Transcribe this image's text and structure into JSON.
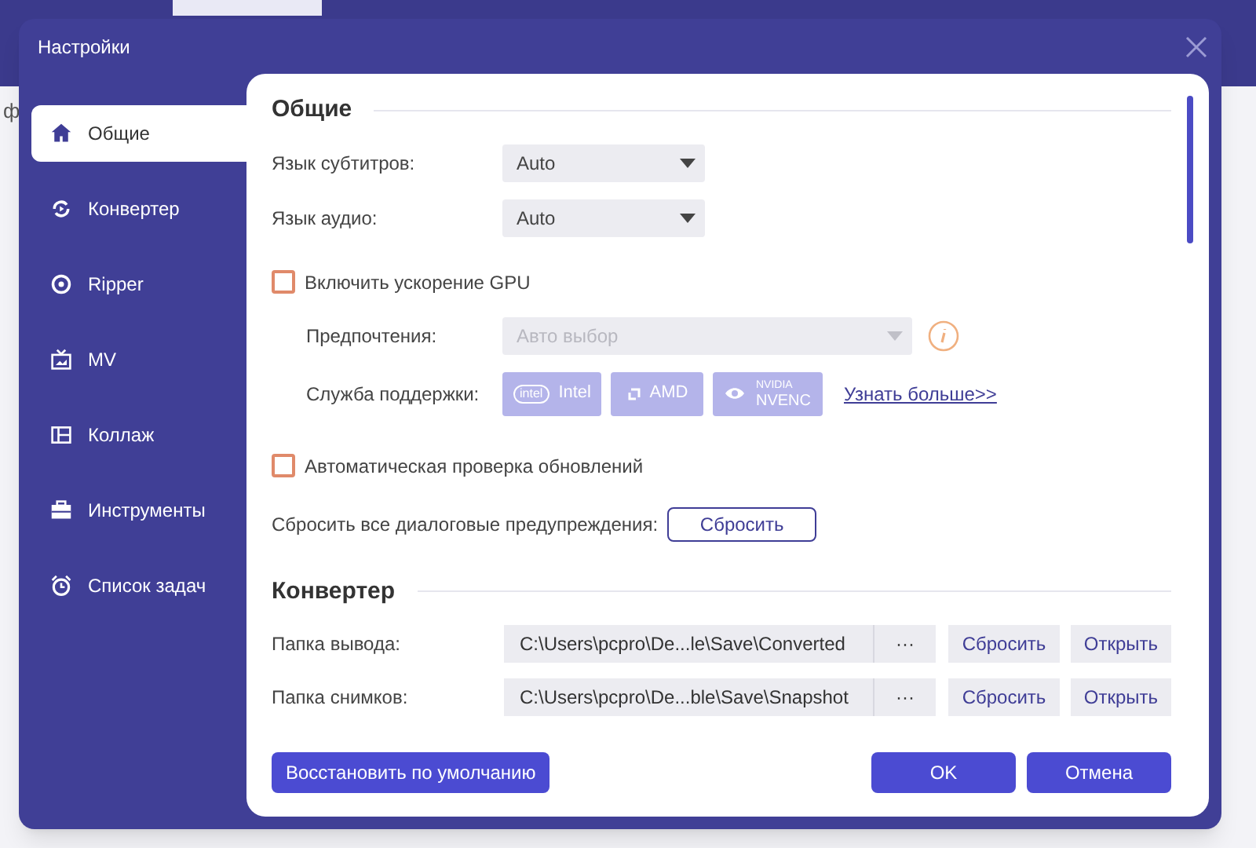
{
  "background": {
    "fragment": "ф"
  },
  "window": {
    "title": "Настройки"
  },
  "sidebar": {
    "items": [
      {
        "label": "Общие",
        "kind": "home",
        "selected": true
      },
      {
        "label": "Конвертер",
        "kind": "convert",
        "selected": false
      },
      {
        "label": "Ripper",
        "kind": "disc",
        "selected": false
      },
      {
        "label": "MV",
        "kind": "tv",
        "selected": false
      },
      {
        "label": "Коллаж",
        "kind": "collage",
        "selected": false
      },
      {
        "label": "Инструменты",
        "kind": "toolbox",
        "selected": false
      },
      {
        "label": "Список задач",
        "kind": "alarm",
        "selected": false
      }
    ]
  },
  "general": {
    "title": "Общие",
    "subtitle_language": {
      "label": "Язык субтитров:",
      "value": "Auto"
    },
    "audio_language": {
      "label": "Язык аудио:",
      "value": "Auto"
    },
    "gpu": {
      "label": "Включить ускорение GPU",
      "checked": false
    },
    "preference": {
      "label": "Предпочтения:",
      "value": "Авто выбор",
      "disabled": true
    },
    "support": {
      "label": "Служба поддержки:",
      "vendors": [
        {
          "kind": "intel",
          "logo": "intel",
          "label": "Intel"
        },
        {
          "kind": "amd",
          "label": "AMD"
        },
        {
          "kind": "nvidia",
          "logo": "NVIDIA",
          "label": "NVENC"
        }
      ],
      "link": "Узнать больше>>"
    },
    "auto_update": {
      "label": "Автоматическая проверка обновлений",
      "checked": false
    },
    "reset_warnings": {
      "label": "Сбросить все диалоговые предупреждения:",
      "button": "Сбросить"
    }
  },
  "converter": {
    "title": "Конвертер",
    "folders": [
      {
        "label": "Папка вывода:",
        "path": "C:\\Users\\pcpro\\De...le\\Save\\Converted",
        "browse": "···",
        "reset": "Сбросить",
        "open": "Открыть"
      },
      {
        "label": "Папка снимков:",
        "path": "C:\\Users\\pcpro\\De...ble\\Save\\Snapshot",
        "browse": "···",
        "reset": "Сбросить",
        "open": "Открыть"
      }
    ]
  },
  "buttons": {
    "restore": "Восстановить по умолчанию",
    "ok": "OK",
    "cancel": "Отмена"
  }
}
